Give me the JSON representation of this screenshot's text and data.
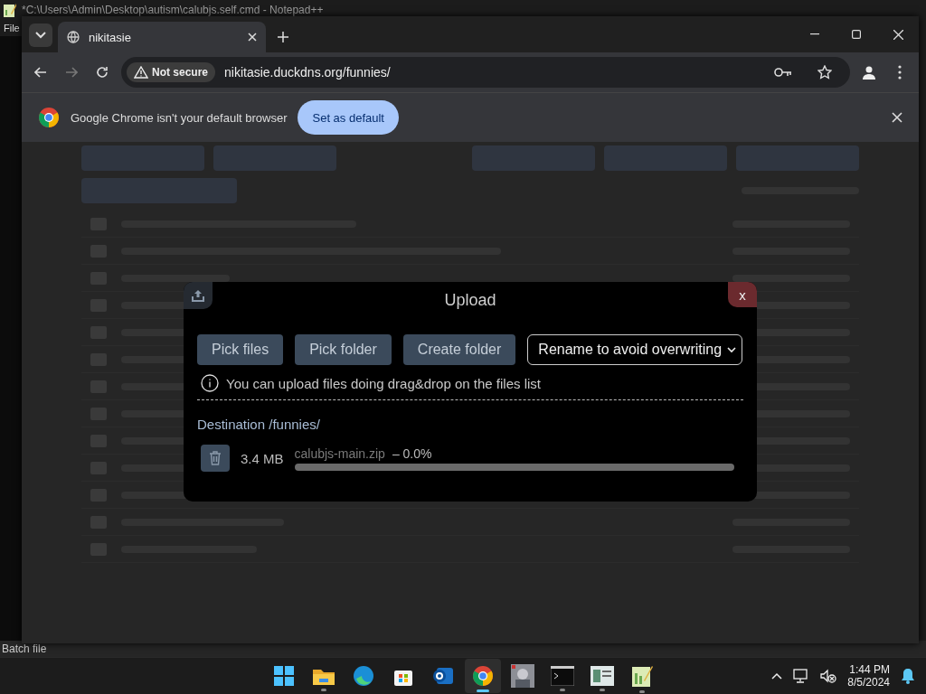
{
  "notepad": {
    "title": "*C:\\Users\\Admin\\Desktop\\autism\\calubjs.self.cmd - Notepad++",
    "menu": [
      "File"
    ],
    "status": "Batch file"
  },
  "browser": {
    "tabs": [
      {
        "label": "nikitasie",
        "selected": true
      }
    ],
    "security": "Not secure",
    "url": "nikitasie.duckdns.org/funnies/",
    "infobar": {
      "message": "Google Chrome isn't your default browser",
      "button": "Set as default"
    }
  },
  "upload": {
    "title": "Upload",
    "close": "x",
    "buttons": [
      "Pick files",
      "Pick folder",
      "Create folder"
    ],
    "mode": "Rename to avoid overwriting",
    "hint": "You can upload files doing drag&drop on the files list",
    "destination": "Destination /funnies/",
    "files": [
      {
        "size": "3.4 MB",
        "name": "calubjs-main.zip",
        "progress": "– 0.0%",
        "level": 0
      }
    ]
  },
  "taskbar": {
    "apps": [
      {
        "kind": "start",
        "selected": false,
        "running": false
      },
      {
        "kind": "folder",
        "selected": false,
        "running": true
      },
      {
        "kind": "edge",
        "selected": false,
        "running": false
      },
      {
        "kind": "store",
        "selected": false,
        "running": false
      },
      {
        "kind": "mail",
        "selected": false,
        "running": false
      },
      {
        "kind": "chrome",
        "selected": true,
        "running": true
      },
      {
        "kind": "game",
        "selected": false,
        "running": false
      },
      {
        "kind": "terminal",
        "selected": false,
        "running": true
      },
      {
        "kind": "window",
        "selected": false,
        "running": true
      },
      {
        "kind": "notepad",
        "selected": false,
        "running": true
      }
    ],
    "time": "1:44 PM",
    "date": "8/5/2024"
  }
}
